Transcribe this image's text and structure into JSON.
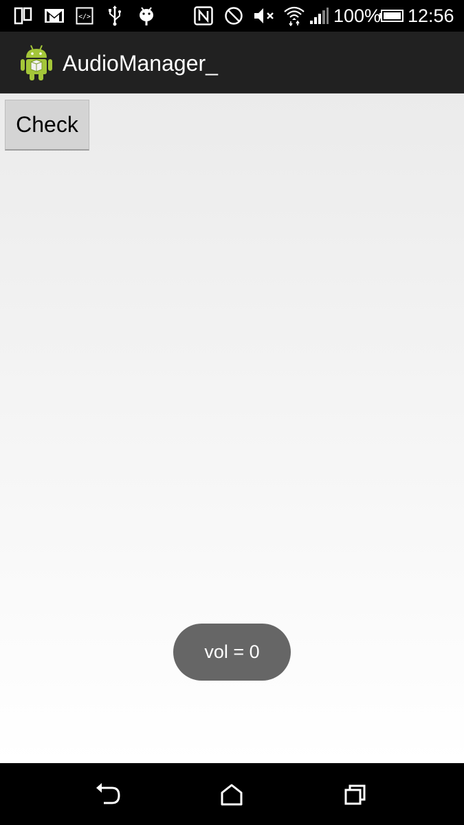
{
  "status_bar": {
    "battery_percent": "100%",
    "time": "12:56",
    "icons": [
      "dual-screen-icon",
      "gmail-icon",
      "code-icon",
      "usb-icon",
      "android-debug-icon",
      "nfc-icon",
      "do-not-disturb-icon",
      "mute-icon",
      "wifi-icon",
      "signal-icon",
      "battery-icon"
    ]
  },
  "action_bar": {
    "title": "AudioManager_",
    "icon": "android-app-icon"
  },
  "content": {
    "check_button_label": "Check"
  },
  "toast": {
    "message": "vol = 0"
  },
  "navigation_bar": {
    "icons": [
      "back-icon",
      "home-icon",
      "recents-icon"
    ]
  },
  "colors": {
    "status_bar_bg": "#000000",
    "action_bar_bg": "#212121",
    "button_bg": "#d4d4d4",
    "toast_bg": "#666666",
    "android_green": "#a4c639"
  }
}
